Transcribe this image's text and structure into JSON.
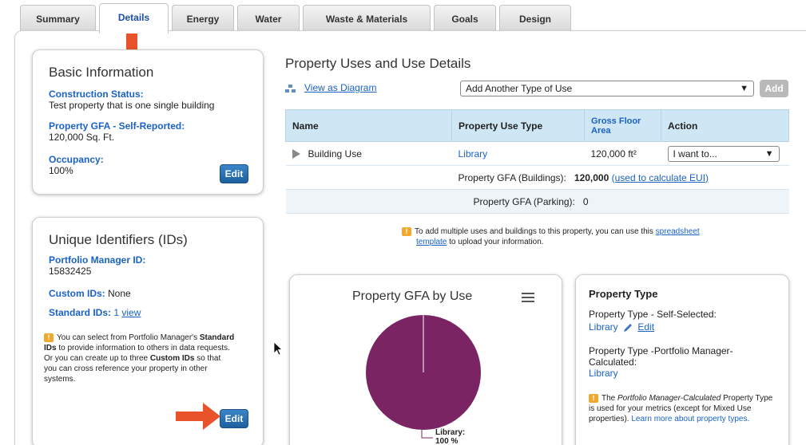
{
  "tabs": [
    "Summary",
    "Details",
    "Energy",
    "Water",
    "Waste & Materials",
    "Goals",
    "Design"
  ],
  "basic_info": {
    "title": "Basic Information",
    "construction_status_label": "Construction Status:",
    "construction_status_value": "Test property that is one single building",
    "gfa_label": "Property GFA - Self-Reported:",
    "gfa_value": "120,000 Sq. Ft.",
    "occupancy_label": "Occupancy:",
    "occupancy_value": "100%",
    "edit_label": "Edit"
  },
  "unique_ids": {
    "title": "Unique Identifiers (IDs)",
    "pm_id_label": "Portfolio Manager ID:",
    "pm_id_value": "15832425",
    "custom_ids_label": "Custom IDs:",
    "custom_ids_value": "None",
    "standard_ids_label": "Standard IDs:",
    "standard_ids_count": "1",
    "standard_ids_link": "view",
    "note_1": "You can select from Portfolio Manager's",
    "note_bold_1": "Standard IDs",
    "note_2": "to provide information to others in data requests. Or you can create up to three",
    "note_bold_2": "Custom IDs",
    "note_3": "so that you can cross reference your property in other systems.",
    "edit_label": "Edit"
  },
  "uses": {
    "title": "Property Uses and Use Details",
    "view_diagram": "View as Diagram",
    "add_select": "Add Another Type of Use",
    "add_button": "Add",
    "headers": [
      "Name",
      "Property Use Type",
      "Gross Floor Area",
      "Action"
    ],
    "row": {
      "name": "Building Use",
      "type": "Library",
      "gfa": "120,000 ft²",
      "action": "I want to..."
    },
    "gfa_buildings_label": "Property GFA (Buildings):",
    "gfa_buildings_value": "120,000",
    "gfa_buildings_link": "(used to calculate EUI)",
    "gfa_parking_label": "Property GFA (Parking):",
    "gfa_parking_value": "0",
    "tip_text": "To add multiple uses and buildings to this property, you can use this",
    "tip_link_1": "spreadsheet",
    "tip_link_2": "template",
    "tip_tail": "to upload your information."
  },
  "chart_data": {
    "type": "pie",
    "title": "Property GFA by Use",
    "categories": [
      "Library"
    ],
    "values": [
      100
    ],
    "slice_label": "Library:",
    "slice_value_label": "100 %",
    "colors": [
      "#7b2463"
    ]
  },
  "property_type": {
    "title": "Property Type",
    "self_selected_label": "Property Type - Self-Selected:",
    "self_selected_value": "Library",
    "edit_link": "Edit",
    "calculated_label": "Property Type -Portfolio Manager-Calculated:",
    "calculated_value": "Library",
    "note_1": "The",
    "note_italic": "Portfolio Manager-Calculated",
    "note_2": "Property Type is used for your metrics (except for Mixed Use properties).",
    "note_link": "Learn more about property types."
  },
  "colors": {
    "accent": "#1a62c6",
    "header_bg": "#cfe6f4",
    "arrow": "#e8532b",
    "pie": "#7b2463"
  }
}
